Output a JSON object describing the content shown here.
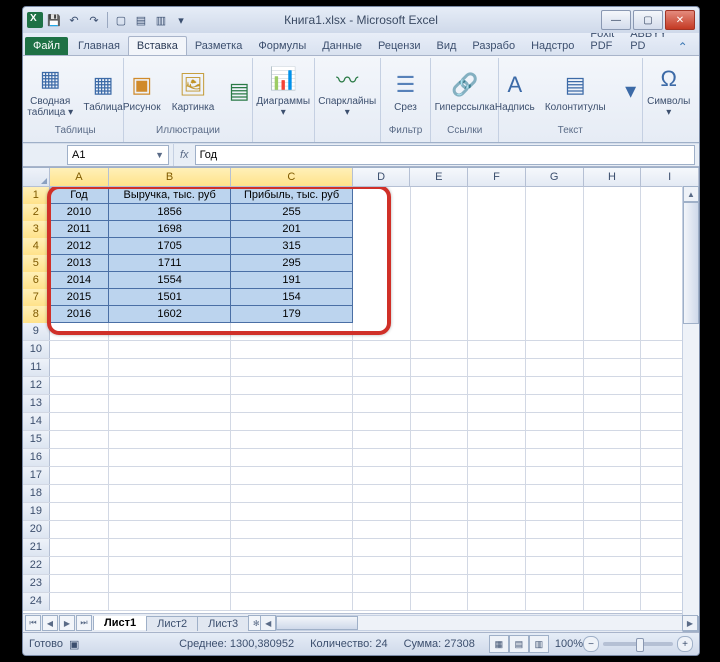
{
  "title": "Книга1.xlsx - Microsoft Excel",
  "qat": {
    "save": "💾",
    "undo": "↶",
    "redo": "↷"
  },
  "tabs": {
    "file": "Файл",
    "items": [
      "Главная",
      "Вставка",
      "Разметка",
      "Формулы",
      "Данные",
      "Рецензи",
      "Вид",
      "Разрабо",
      "Надстро",
      "Foxit PDF",
      "ABBYY PD"
    ],
    "active_index": 1
  },
  "ribbon": {
    "groups": [
      {
        "label": "Таблицы",
        "buttons": [
          {
            "name": "pivot-table",
            "label": "Сводная\nтаблица ▾",
            "icon": "▦",
            "cls": "ic-pivot"
          },
          {
            "name": "table",
            "label": "Таблица",
            "icon": "▦",
            "cls": "ic-table"
          }
        ]
      },
      {
        "label": "Иллюстрации",
        "buttons": [
          {
            "name": "picture",
            "label": "Рисунок",
            "icon": "▣",
            "cls": "ic-pic"
          },
          {
            "name": "clipart",
            "label": "Картинка",
            "icon": "🖼",
            "cls": "ic-clip"
          },
          {
            "name": "shapes-more",
            "label": "",
            "icon": "▤",
            "cls": "ic-shapes",
            "small": true
          }
        ]
      },
      {
        "label": "",
        "buttons": [
          {
            "name": "charts",
            "label": "Диаграммы\n▾",
            "icon": "📊",
            "cls": "ic-chart"
          }
        ]
      },
      {
        "label": "",
        "buttons": [
          {
            "name": "sparklines",
            "label": "Спарклайны\n▾",
            "icon": "〰",
            "cls": "ic-spark"
          }
        ]
      },
      {
        "label": "Фильтр",
        "buttons": [
          {
            "name": "slicer",
            "label": "Срез",
            "icon": "☰",
            "cls": "ic-filter"
          }
        ]
      },
      {
        "label": "Ссылки",
        "buttons": [
          {
            "name": "hyperlink",
            "label": "Гиперссылка",
            "icon": "🔗",
            "cls": "ic-link"
          }
        ]
      },
      {
        "label": "Текст",
        "buttons": [
          {
            "name": "textbox",
            "label": "Надпись",
            "icon": "A",
            "cls": "ic-text"
          },
          {
            "name": "headerfooter",
            "label": "Колонтитулы",
            "icon": "▤",
            "cls": "ic-text"
          },
          {
            "name": "text-more",
            "label": "",
            "icon": "▾",
            "cls": "ic-text",
            "small": true
          }
        ]
      },
      {
        "label": "",
        "buttons": [
          {
            "name": "symbols",
            "label": "Символы\n▾",
            "icon": "Ω",
            "cls": "ic-sym"
          }
        ]
      }
    ]
  },
  "formula": {
    "namebox": "A1",
    "fx": "fx",
    "value": "Год"
  },
  "grid": {
    "columns": [
      "A",
      "B",
      "C",
      "D",
      "E",
      "F",
      "G",
      "H",
      "I"
    ],
    "col_widths": {
      "A": 64,
      "B": 132,
      "C": 132,
      "rest": 62
    },
    "headers": [
      "Год",
      "Выручка, тыс. руб",
      "Прибыль, тыс. руб"
    ],
    "rows": [
      [
        "2010",
        "1856",
        "255"
      ],
      [
        "2011",
        "1698",
        "201"
      ],
      [
        "2012",
        "1705",
        "315"
      ],
      [
        "2013",
        "1711",
        "295"
      ],
      [
        "2014",
        "1554",
        "191"
      ],
      [
        "2015",
        "1501",
        "154"
      ],
      [
        "2016",
        "1602",
        "179"
      ]
    ],
    "visible_rows": 24,
    "selection": {
      "r1": 1,
      "r2": 8,
      "c1": 1,
      "c2": 3
    }
  },
  "sheets": {
    "items": [
      "Лист1",
      "Лист2",
      "Лист3"
    ],
    "active": 0
  },
  "status": {
    "ready": "Готово",
    "avg_label": "Среднее:",
    "avg": "1300,380952",
    "count_label": "Количество:",
    "count": "24",
    "sum_label": "Сумма:",
    "sum": "27308",
    "zoom": "100%"
  }
}
